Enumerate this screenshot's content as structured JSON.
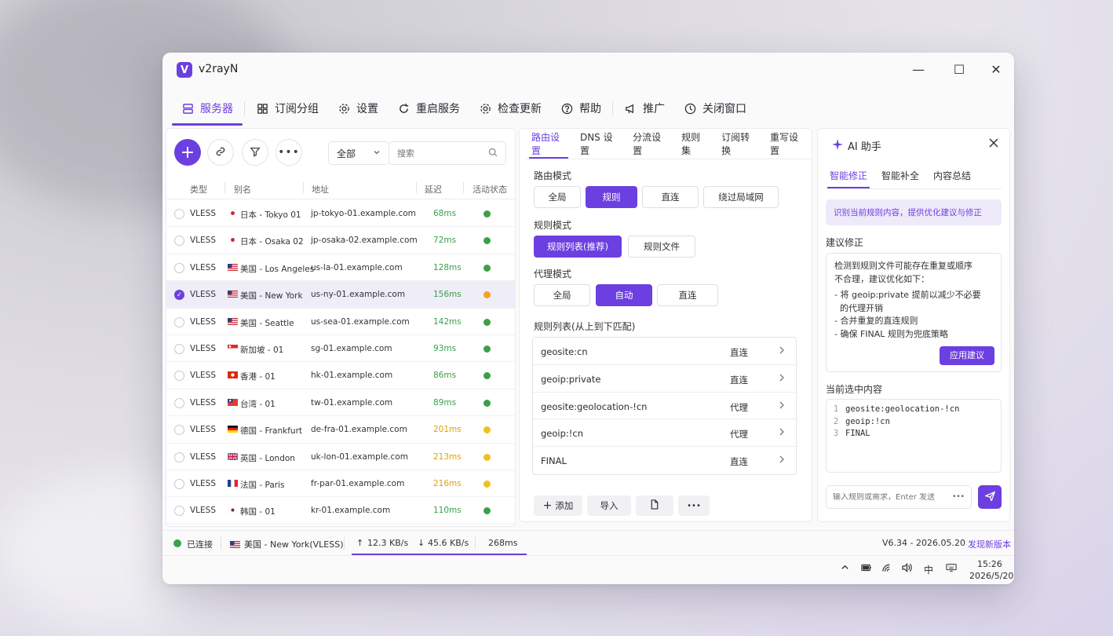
{
  "app": {
    "logo_letter": "V",
    "title": "v2rayN"
  },
  "window_controls": {
    "minimize": "—",
    "maximize": "☐",
    "close": "✕"
  },
  "menu": {
    "servers": "服务器",
    "subscriptions": "订阅分组",
    "settings": "设置",
    "restart": "重启服务",
    "update": "检查更新",
    "help": "帮助",
    "promote": "推广",
    "close_window": "关闭窗口"
  },
  "server_panel": {
    "filter_value": "全部",
    "search_placeholder": "搜索",
    "columns": {
      "type": "类型",
      "alias": "别名",
      "address": "地址",
      "latency": "延迟",
      "status": "活动状态"
    },
    "rows": [
      {
        "type": "VLESS",
        "flag": "jp",
        "alias": "日本 - Tokyo 01",
        "address": "jp-tokyo-01.example.com",
        "latency": "68ms",
        "latency_color": "#3aa04a",
        "status_color": "#3aa04a",
        "selected": false
      },
      {
        "type": "VLESS",
        "flag": "jp",
        "alias": "日本 - Osaka 02",
        "address": "jp-osaka-02.example.com",
        "latency": "72ms",
        "latency_color": "#3aa04a",
        "status_color": "#3aa04a",
        "selected": false
      },
      {
        "type": "VLESS",
        "flag": "us",
        "alias": "美国 - Los Angeles",
        "address": "us-la-01.example.com",
        "latency": "128ms",
        "latency_color": "#3aa04a",
        "status_color": "#3aa04a",
        "selected": false
      },
      {
        "type": "VLESS",
        "flag": "us",
        "alias": "美国 - New York",
        "address": "us-ny-01.example.com",
        "latency": "156ms",
        "latency_color": "#3aa04a",
        "status_color": "#f0a520",
        "selected": true
      },
      {
        "type": "VLESS",
        "flag": "us",
        "alias": "美国 - Seattle",
        "address": "us-sea-01.example.com",
        "latency": "142ms",
        "latency_color": "#3aa04a",
        "status_color": "#3aa04a",
        "selected": false
      },
      {
        "type": "VLESS",
        "flag": "sg",
        "alias": "新加坡 - 01",
        "address": "sg-01.example.com",
        "latency": "93ms",
        "latency_color": "#3aa04a",
        "status_color": "#3aa04a",
        "selected": false
      },
      {
        "type": "VLESS",
        "flag": "hk",
        "alias": "香港 - 01",
        "address": "hk-01.example.com",
        "latency": "86ms",
        "latency_color": "#3aa04a",
        "status_color": "#3aa04a",
        "selected": false
      },
      {
        "type": "VLESS",
        "flag": "tw",
        "alias": "台湾 - 01",
        "address": "tw-01.example.com",
        "latency": "89ms",
        "latency_color": "#3aa04a",
        "status_color": "#3aa04a",
        "selected": false
      },
      {
        "type": "VLESS",
        "flag": "de",
        "alias": "德国 - Frankfurt",
        "address": "de-fra-01.example.com",
        "latency": "201ms",
        "latency_color": "#e0a010",
        "status_color": "#f0c020",
        "selected": false
      },
      {
        "type": "VLESS",
        "flag": "gb",
        "alias": "英国 - London",
        "address": "uk-lon-01.example.com",
        "latency": "213ms",
        "latency_color": "#e0a010",
        "status_color": "#f0c020",
        "selected": false
      },
      {
        "type": "VLESS",
        "flag": "fr",
        "alias": "法国 - Paris",
        "address": "fr-par-01.example.com",
        "latency": "216ms",
        "latency_color": "#e0a010",
        "status_color": "#f0c020",
        "selected": false
      },
      {
        "type": "VLESS",
        "flag": "kr",
        "alias": "韩国 - 01",
        "address": "kr-01.example.com",
        "latency": "110ms",
        "latency_color": "#3aa04a",
        "status_color": "#3aa04a",
        "selected": false
      }
    ]
  },
  "routing_panel": {
    "tabs": [
      "路由设置",
      "DNS 设置",
      "分流设置",
      "规则集",
      "订阅转换",
      "重写设置"
    ],
    "route_mode_label": "路由模式",
    "route_modes": [
      "全局",
      "规则",
      "直连",
      "绕过局域网"
    ],
    "route_mode_active": 1,
    "rule_mode_label": "规则模式",
    "rule_modes": [
      "规则列表(推荐)",
      "规则文件"
    ],
    "rule_mode_active": 0,
    "proxy_mode_label": "代理模式",
    "proxy_modes": [
      "全局",
      "自动",
      "直连"
    ],
    "proxy_mode_active": 1,
    "rule_list_label": "规则列表(从上到下匹配)",
    "rules": [
      {
        "match": "geosite:cn",
        "action": "直连"
      },
      {
        "match": "geoip:private",
        "action": "直连"
      },
      {
        "match": "geosite:geolocation-!cn",
        "action": "代理"
      },
      {
        "match": "geoip:!cn",
        "action": "代理"
      },
      {
        "match": "FINAL",
        "action": "直连"
      }
    ],
    "actions": {
      "add": "添加",
      "import": "导入"
    }
  },
  "ai_panel": {
    "title": "AI 助手",
    "tabs": [
      "智能修正",
      "智能补全",
      "内容总结"
    ],
    "hint": "识别当前规则内容，提供优化建议与修正",
    "suggest_label": "建议修正",
    "suggest_intro_1": "检测到规则文件可能存在重复或顺序",
    "suggest_intro_2": "不合理，建议优化如下：",
    "suggest_item_1a": "- 将 geoip:private 提前以减少不必要",
    "suggest_item_1b": "  的代理开销",
    "suggest_item_2": "- 合并重复的直连规则",
    "suggest_item_3": "- 确保 FINAL 规则为兜底策略",
    "apply": "应用建议",
    "selection_label": "当前选中内容",
    "code_lines": [
      "geosite:geolocation-!cn",
      "geoip:!cn",
      "FINAL"
    ],
    "input_placeholder": "输入规则或需求，Enter 发送"
  },
  "statusbar": {
    "connected": "已连接",
    "server": "美国 - New York(VLESS)",
    "upload": "12.3 KB/s",
    "download": "45.6 KB/s",
    "latency": "268ms",
    "version": "V6.34 - 2026.05.20",
    "new_version": "发现新版本"
  },
  "taskbar": {
    "ime": "中",
    "time": "15:26",
    "date": "2026/5/20"
  },
  "colors": {
    "accent": "#6c3fe0"
  }
}
